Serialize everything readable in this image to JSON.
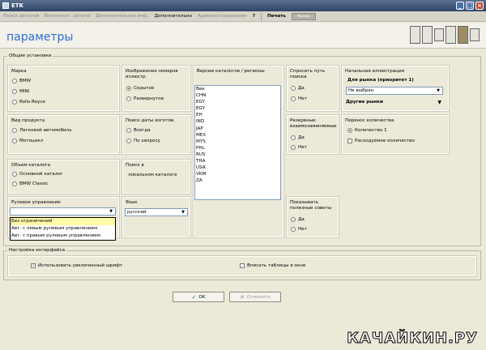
{
  "window": {
    "title": "ETK"
  },
  "menu": {
    "items": [
      "Поиск деталей",
      "Вспомогат. детали",
      "Дополнительная инф.",
      "Дополнительно",
      "Администрирование",
      "?",
      "Печать"
    ],
    "extra_button": "Выход"
  },
  "header": {
    "page_title": "параметры"
  },
  "general": {
    "legend": "Общие установки",
    "brand": {
      "title": "Марка",
      "options": [
        "BMW",
        "MINI",
        "Rolls-Royce"
      ]
    },
    "product": {
      "title": "Вид продукта",
      "options": [
        "Легковой автомобиль",
        "Мотоцикл"
      ]
    },
    "catalog_scope": {
      "title": "Объем каталога",
      "options": [
        "Основной каталог",
        "BMW Classic"
      ]
    },
    "steering": {
      "title": "Рулевое управление",
      "value": "",
      "options": [
        "Без ограничений",
        "Авт. с левым рулевым управлением",
        "Авт. с правым рулевым управлением"
      ]
    },
    "illustration_numbers": {
      "title": "Изображение номеров иллюстр.",
      "options": [
        "Скрытое",
        "Развернутое"
      ],
      "selected": 0
    },
    "date_search": {
      "title": "Поиск даты изготов.",
      "options": [
        "Всегда",
        "По запросу"
      ]
    },
    "search_in": {
      "title": "Поиск в",
      "value": "локальном каталоге"
    },
    "language": {
      "title": "Язык",
      "value": "русский"
    },
    "catalog_versions": {
      "title": "Версии каталогов / регионы",
      "items": [
        "Bee",
        "CHN",
        "EGY",
        "EGY",
        "EH",
        "IND",
        "JAP",
        "MEX",
        "MYS",
        "PHL",
        "RUS",
        "THA",
        "USA",
        "VKM",
        "ZA"
      ]
    },
    "ask_search_path": {
      "title": "Спросить путь поиска",
      "options": [
        "Да",
        "Нет"
      ]
    },
    "reserved_interchange": {
      "title": "Резервные взаимозаменяемые",
      "options": [
        "Да",
        "Нет"
      ]
    },
    "show_tips": {
      "title": "Показывать полезные советы",
      "options": [
        "Да",
        "Нет"
      ]
    },
    "start_illustration": {
      "title": "Начальная иллюстрация",
      "market_label": "Для рынка (приоритет 1)",
      "market_value": "Не выбран",
      "other_markets": "Другие рынки"
    },
    "quantity_transfer": {
      "title": "Перенос количества",
      "radio_label": "Количество 1",
      "check_label": "Расходуемое количество"
    }
  },
  "interface": {
    "legend": "Настройка интерфейса",
    "large_font": "Использовать увеличенный шрифт",
    "table_window": "Вписать таблицы в окне"
  },
  "buttons": {
    "ok": "OK",
    "cancel": "Отменить"
  },
  "watermark": "КАЧАЙКИН.РУ",
  "colors": {
    "accent": "#2d6fd0",
    "highlight": "#fffaa8",
    "check_green": "#1c6e1c"
  }
}
